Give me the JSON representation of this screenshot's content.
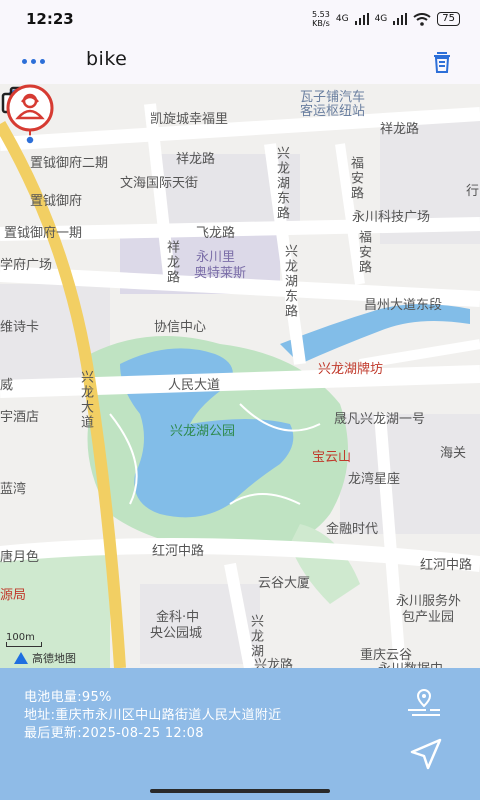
{
  "status": {
    "time": "12:23",
    "speed_value": "5.53",
    "speed_unit": "KB/s",
    "network1": "4G",
    "network2": "4G",
    "battery": "75"
  },
  "appbar": {
    "title": "bike"
  },
  "map": {
    "labels": [
      {
        "key": "wawa",
        "text": "瓦子铺汽车"
      },
      {
        "key": "wawa2",
        "text": "客运枢纽站"
      },
      {
        "key": "kaixuan",
        "text": "凯旋城幸福里"
      },
      {
        "key": "xianglong1",
        "text": "祥龙路"
      },
      {
        "key": "xianglong2",
        "text": "祥龙路"
      },
      {
        "key": "zhiyue2",
        "text": "置钺御府二期"
      },
      {
        "key": "wenhai",
        "text": "文海国际天街"
      },
      {
        "key": "zhiyue",
        "text": "置钺御府"
      },
      {
        "key": "zhiyue1",
        "text": "置钺御府一期"
      },
      {
        "key": "xuefu",
        "text": "学府广场"
      },
      {
        "key": "feilong",
        "text": "飞龙路"
      },
      {
        "key": "yongchuanli",
        "text": "永川里"
      },
      {
        "key": "aoteleisi",
        "text": "奥特莱斯"
      },
      {
        "key": "xinglonghudong",
        "text": "兴龙湖东路"
      },
      {
        "key": "xinglonghudong2",
        "text": "兴龙湖东路"
      },
      {
        "key": "fuan",
        "text": "福安路"
      },
      {
        "key": "fuan2",
        "text": "福安路"
      },
      {
        "key": "keji",
        "text": "永川科技广场"
      },
      {
        "key": "xianglong3",
        "text": "祥龙路"
      },
      {
        "key": "changzhou",
        "text": "昌州大道东段"
      },
      {
        "key": "weishi",
        "text": "维诗卡"
      },
      {
        "key": "xiexin",
        "text": "协信中心"
      },
      {
        "key": "xinglongdadao",
        "text": "兴龙大道"
      },
      {
        "key": "renmin",
        "text": "人民大道"
      },
      {
        "key": "paifang",
        "text": "兴龙湖牌坊"
      },
      {
        "key": "jiudian",
        "text": "宇酒店"
      },
      {
        "key": "park",
        "text": "兴龙湖公园"
      },
      {
        "key": "shengfan",
        "text": "晟凡兴龙湖一号"
      },
      {
        "key": "haiguan",
        "text": "海关"
      },
      {
        "key": "baoyun",
        "text": "宝云山"
      },
      {
        "key": "longwan",
        "text": "龙湾星座"
      },
      {
        "key": "jinrong",
        "text": "金融时代"
      },
      {
        "key": "honghe",
        "text": "红河中路"
      },
      {
        "key": "honghe2",
        "text": "红河中路"
      },
      {
        "key": "yungu",
        "text": "云谷大厦"
      },
      {
        "key": "fuwu",
        "text": "永川服务外"
      },
      {
        "key": "fuwu2",
        "text": "包产业园"
      },
      {
        "key": "jinke",
        "text": "金科·中"
      },
      {
        "key": "jinke2",
        "text": "央公园城"
      },
      {
        "key": "xinglonglu",
        "text": "兴龙湖"
      },
      {
        "key": "xinglong4",
        "text": "兴龙路"
      },
      {
        "key": "yungu2",
        "text": "重庆云谷"
      },
      {
        "key": "yungu3",
        "text": "永川数据中"
      },
      {
        "key": "lanwan",
        "text": "蓝湾"
      },
      {
        "key": "tangyue",
        "text": "唐月色"
      },
      {
        "key": "yuanju",
        "text": "源局"
      },
      {
        "key": "wei",
        "text": "威"
      },
      {
        "key": "hang",
        "text": "行"
      }
    ],
    "scale": "100m",
    "logo": "高德地图"
  },
  "panel": {
    "battery_line": "电池电量:95%",
    "address_line": "地址:重庆市永川区中山路街道人民大道附近",
    "updated_line": "最后更新:2025-08-25 12:08"
  }
}
